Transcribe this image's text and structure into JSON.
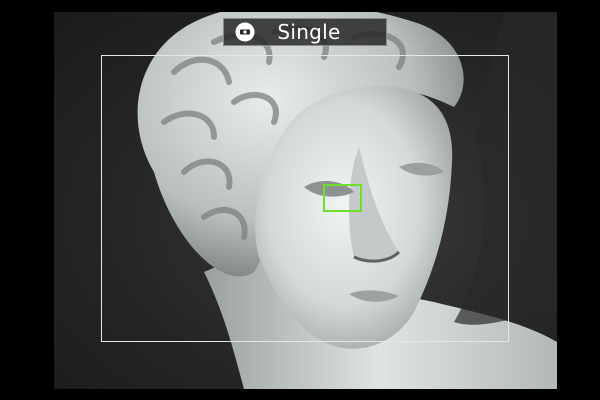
{
  "live_view": {
    "release_mode": {
      "label": "Single",
      "icon": "autofocus-mode-icon"
    },
    "af_area_frame": {
      "icon": "af-area-frame"
    },
    "focus_point": {
      "color": "#6fe02a"
    },
    "colors": {
      "banner_background": "#282828",
      "banner_text": "#ffffff",
      "frame": "#e6e6e6",
      "screen_border": "#000000"
    }
  }
}
